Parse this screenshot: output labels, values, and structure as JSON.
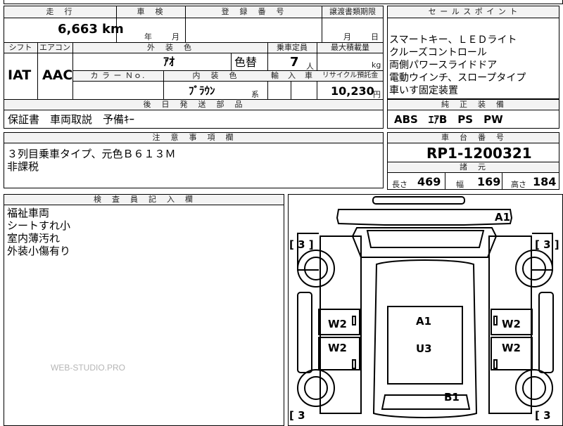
{
  "header": {
    "mileage_label": "走　行",
    "shaken_label": "車　検",
    "reg_label": "登　録　番　号",
    "transfer_label": "譲渡書類期限",
    "sales_label": "セ ー ル ス ポ イ ン ト"
  },
  "vehicle": {
    "mileage": "6,663",
    "mileage_unit": "km",
    "shaken_year_unit": "年",
    "shaken_month_unit": "月",
    "transfer_month_unit": "月",
    "transfer_day_unit": "日"
  },
  "row2": {
    "shift_label": "シフト",
    "ac_label": "エアコン",
    "exterior_label": "外　装　色",
    "capacity_label": "乗車定員",
    "max_load_label": "最大積載量",
    "shift": "IAT",
    "ac": "AAC",
    "exterior_color": "ｱｵ",
    "repaint": "色替",
    "capacity": "7",
    "capacity_unit": "人",
    "max_load_unit": "kg",
    "color_no_label": "カ ラ ー Ｎｏ.",
    "interior_label": "内　装　色",
    "import_label": "輸　入　車",
    "recycle_label": "リサイクル預託金",
    "interior_color": "ﾌﾞﾗｳﾝ",
    "interior_suffix": "系",
    "recycle_fee": "10,230",
    "recycle_unit": "円"
  },
  "sales_points": [
    "スマートキー、ＬＥＤライト",
    "クルーズコントロール",
    "両側パワースライドドア",
    "電動ウインチ、スロープタイプ",
    "車いす固定装置"
  ],
  "accessories": {
    "label": "後　日　発　送　部　品",
    "value": "保証書　車両取説　予備ｷｰ"
  },
  "equipment": {
    "label": "純　正　装　備",
    "value": "ABS　ｴｱB　PS　PW"
  },
  "notes": {
    "label": "注　意　事　項　欄",
    "lines": [
      "３列目乗車タイプ、元色Ｂ６１３Ｍ",
      "非課税"
    ]
  },
  "chassis": {
    "label": "車　台　番　号",
    "value": "RP1-1200321"
  },
  "specs": {
    "label": "諸　元",
    "length_label": "長さ",
    "length": "469",
    "width_label": "幅",
    "width": "169",
    "height_label": "高さ",
    "height": "184"
  },
  "inspector": {
    "label": "検　査　員　記　入　欄",
    "lines": [
      "福祉車両",
      "シートすれ小",
      "室内薄汚れ",
      "外装小傷有り"
    ]
  },
  "diagram": {
    "marks": {
      "front_roof": "A1",
      "roof": "A1",
      "roof_center": "U3",
      "rear": "B1",
      "left_front_window": "W2",
      "right_front_window": "W2",
      "left_rear_window": "W2",
      "right_rear_window": "W2"
    },
    "tire_tl": "[ 3 ]",
    "tire_tr": "[ 3 ]",
    "tire_bl": "[ 3",
    "tire_br": "[ 3"
  },
  "watermark": "WEB-STUDIO.PRO"
}
